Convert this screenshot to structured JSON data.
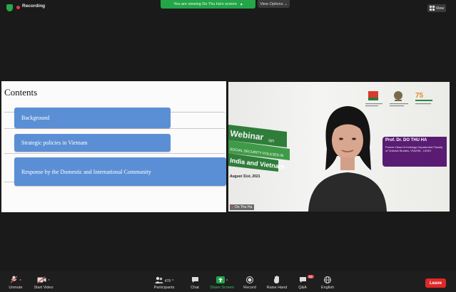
{
  "topbar": {
    "recording_label": "Recording",
    "viewing_banner": "You are viewing Do Thu Ha's screen",
    "view_options_label": "View Options ⌄",
    "view_label": "View"
  },
  "slide": {
    "title": "Contents",
    "items": [
      "Background",
      "Strategic policies in Vietnam",
      "Response by the Domestic and International Community"
    ]
  },
  "video": {
    "banner_line1": "Webinar",
    "banner_word2": "on",
    "banner_line2": "SOCIAL SECURITY POLICIES IN",
    "banner_line3": "India and Vietnam",
    "banner_date": "August 31st, 2021",
    "nameplate_title": "Prof. Dr. DO THU HA",
    "nameplate_desc": "Former Head of Indology Department Faculty of Oriental Studies, VNUHN - USSH",
    "participant_name": "Do Thu Ha"
  },
  "toolbar": {
    "unmute": "Unmute",
    "start_video": "Start Video",
    "participants": "Participants",
    "participants_count": "478",
    "chat": "Chat",
    "share_screen": "Share Screen",
    "record": "Record",
    "raise_hand": "Raise Hand",
    "qa": "Q&A",
    "qa_badge": "23",
    "english": "English",
    "leave": "Leave"
  },
  "colors": {
    "share_green": "#23a548",
    "slide_box_blue": "#5b8fd5",
    "nameplate_purple": "#5a1c73",
    "leave_red": "#e02828"
  }
}
